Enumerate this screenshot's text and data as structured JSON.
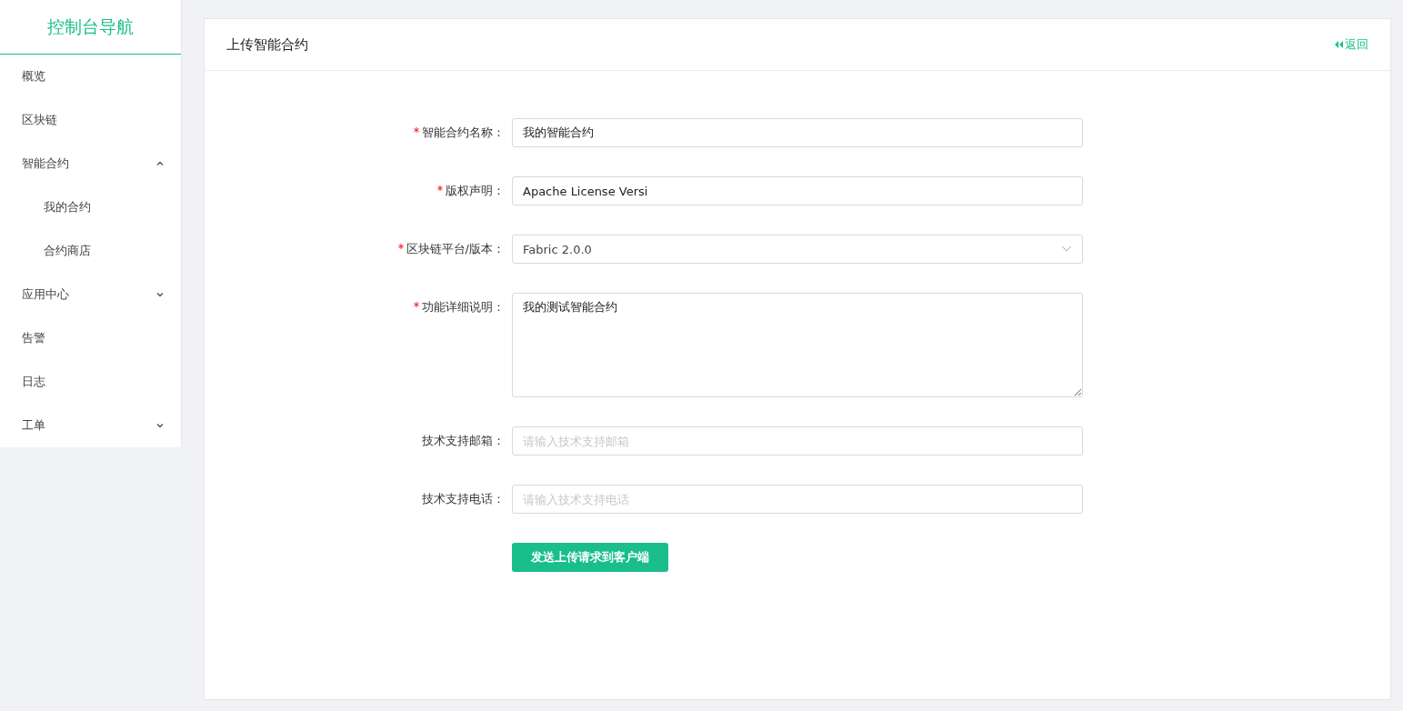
{
  "sidebar": {
    "title": "控制台导航",
    "items": [
      {
        "label": "概览"
      },
      {
        "label": "区块链"
      },
      {
        "label": "智能合约",
        "expanded": true,
        "children": [
          {
            "label": "我的合约"
          },
          {
            "label": "合约商店"
          }
        ]
      },
      {
        "label": "应用中心",
        "expanded": false
      },
      {
        "label": "告警"
      },
      {
        "label": "日志"
      },
      {
        "label": "工单",
        "expanded": false
      }
    ]
  },
  "card": {
    "title": "上传智能合约",
    "back_link": "返回"
  },
  "form": {
    "fields": [
      {
        "kind": "text",
        "label": "智能合约名称：",
        "required": true,
        "value": "我的智能合约"
      },
      {
        "kind": "text",
        "label": "版权声明：",
        "required": true,
        "value": "Apache License Versi"
      },
      {
        "kind": "select",
        "label": "区块链平台/版本：",
        "required": true,
        "value": "Fabric 2.0.0"
      },
      {
        "kind": "textarea",
        "label": "功能详细说明：",
        "required": true,
        "value": "我的测试智能合约"
      },
      {
        "kind": "text",
        "label": "技术支持邮箱：",
        "required": false,
        "placeholder": "请输入技术支持邮箱"
      },
      {
        "kind": "text",
        "label": "技术支持电话：",
        "required": false,
        "placeholder": "请输入技术支持电话"
      }
    ],
    "submit": "发送上传请求到客户端"
  }
}
